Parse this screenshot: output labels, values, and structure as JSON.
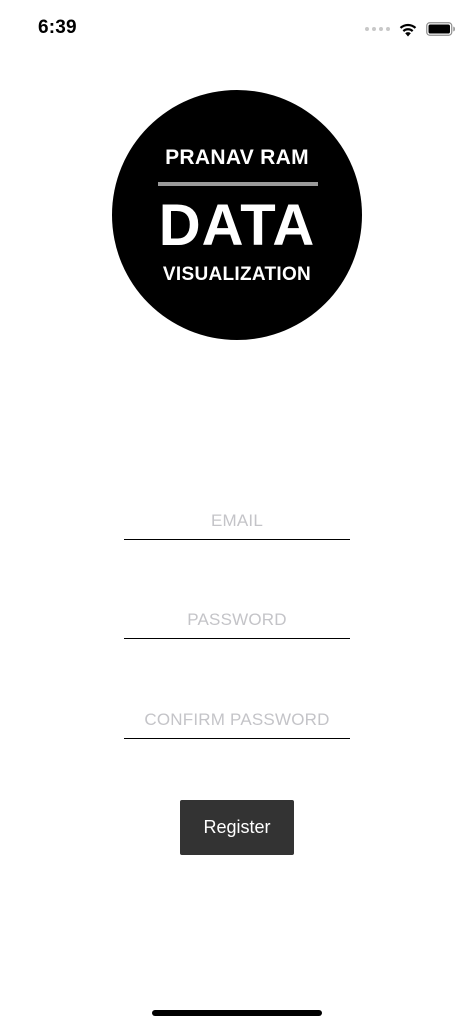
{
  "status_bar": {
    "time": "6:39",
    "icons": [
      "signal-dots-icon",
      "wifi-icon",
      "battery-icon"
    ]
  },
  "logo": {
    "top_text": "PRANAV RAM",
    "main_text": "DATA",
    "bottom_text": "VISUALIZATION"
  },
  "form": {
    "email_placeholder": "EMAIL",
    "email_value": "",
    "password_placeholder": "PASSWORD",
    "password_value": "",
    "confirm_placeholder": "CONFIRM PASSWORD",
    "confirm_value": "",
    "register_label": "Register"
  },
  "colors": {
    "background": "#ffffff",
    "logo_fill": "#000000",
    "logo_rule": "#9a9a9a",
    "button_fill": "#333333",
    "placeholder": "#c4c4c8"
  }
}
